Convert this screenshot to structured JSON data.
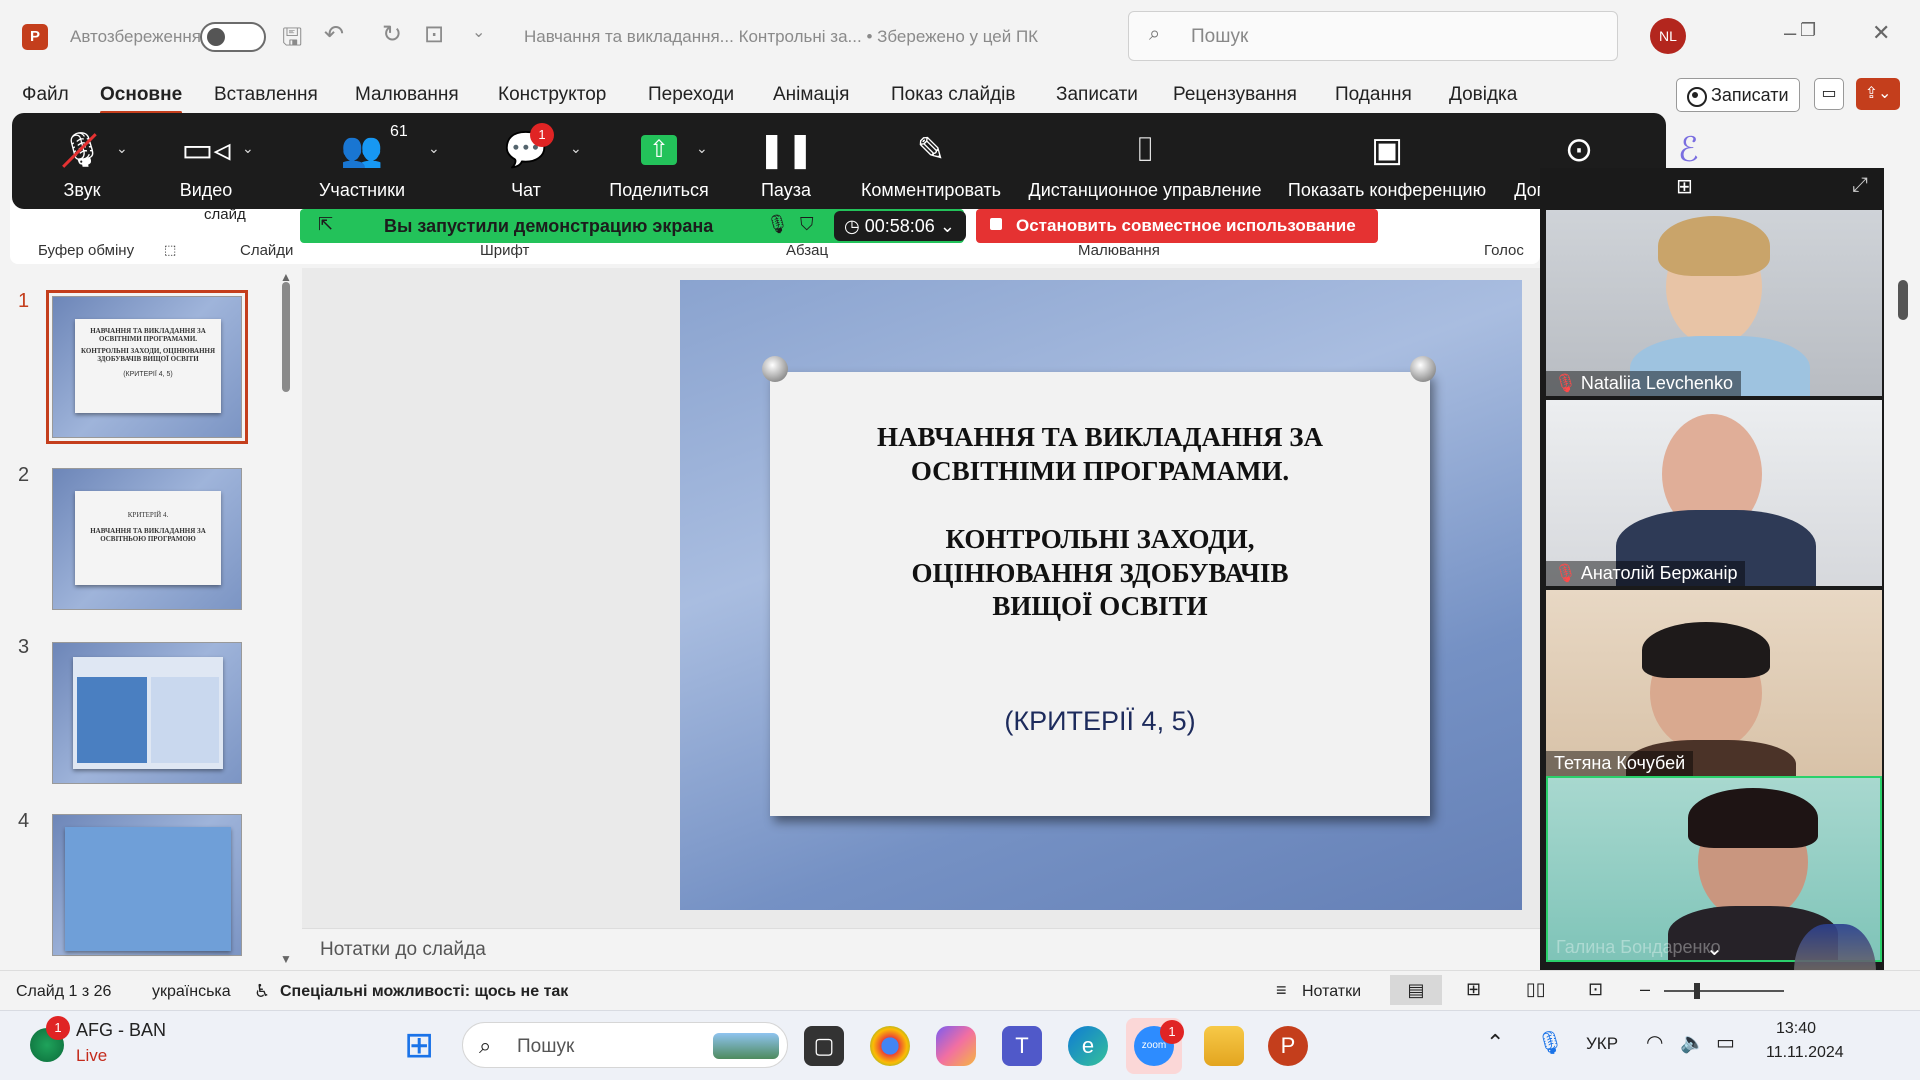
{
  "titlebar": {
    "autosave_label": "Автозбереження",
    "doc_title": "Навчання та викладання... Контрольні за... • Збережено у цей ПК",
    "search_placeholder": "Пошук",
    "user_initials": "NL"
  },
  "menu": {
    "items": [
      "Файл",
      "Основне",
      "Вставлення",
      "Малювання",
      "Конструктор",
      "Переходи",
      "Анімація",
      "Показ слайдів",
      "Записати",
      "Рецензування",
      "Подання",
      "Довідка"
    ],
    "active": "Основне",
    "record_label": "Записати"
  },
  "ribbon": {
    "groups": [
      "Буфер обміну",
      "Слайди",
      "Шрифт",
      "Абзац",
      "Малювання",
      "Голос"
    ],
    "slide_dropdown": "слайд"
  },
  "zoom": {
    "items": [
      {
        "label": "Звук",
        "icon": "mic-muted-icon"
      },
      {
        "label": "Видео",
        "icon": "video-camera-icon"
      },
      {
        "label": "Участники",
        "icon": "participants-icon",
        "count": "61"
      },
      {
        "label": "Чат",
        "icon": "chat-icon",
        "badge": "1"
      },
      {
        "label": "Поделиться",
        "icon": "share-screen-icon"
      },
      {
        "label": "Пауза",
        "icon": "pause-icon"
      },
      {
        "label": "Комментировать",
        "icon": "annotate-pen-icon"
      },
      {
        "label": "Дистанционное управление",
        "icon": "remote-control-mouse-icon"
      },
      {
        "label": "Показать конференцию",
        "icon": "show-meeting-icon"
      },
      {
        "label": "Дополнительно",
        "icon": "more-icon"
      }
    ],
    "share_status": "Вы запустили демонстрацию экрана",
    "timer": "00:58:06",
    "stop_share": "Остановить совместное использование"
  },
  "slides_panel": {
    "slides": [
      {
        "num": "1",
        "line1": "НАВЧАННЯ ТА ВИКЛАДАННЯ ЗА ОСВІТНІМИ ПРОГРАМАМИ.",
        "line2": "КОНТРОЛЬНІ ЗАХОДИ, ОЦІНЮВАННЯ ЗДОБУВАЧІВ ВИЩОЇ ОСВІТИ",
        "line3": "(КРИТЕРІЇ 4, 5)"
      },
      {
        "num": "2",
        "line1": "КРИТЕРІЙ 4.",
        "line2": "НАВЧАННЯ ТА ВИКЛАДАННЯ ЗА ОСВІТНЬОЮ ПРОГРАМОЮ"
      },
      {
        "num": "3"
      },
      {
        "num": "4"
      }
    ]
  },
  "main_slide": {
    "title_line1": "НАВЧАННЯ ТА ВИКЛАДАННЯ ЗА",
    "title_line2": "ОСВІТНІМИ ПРОГРАМАМИ.",
    "title_line3": "КОНТРОЛЬНІ ЗАХОДИ,",
    "title_line4": "ОЦІНЮВАННЯ ЗДОБУВАЧІВ",
    "title_line5": "ВИЩОЇ ОСВІТИ",
    "subtitle": "(КРИТЕРІЇ 4, 5)"
  },
  "notes_placeholder": "Нотатки до слайда",
  "participants": [
    {
      "name": "Nataliia Levchenko",
      "muted": true
    },
    {
      "name": "Анатолій Бержанір",
      "muted": true
    },
    {
      "name": "Тетяна Кочубей",
      "muted": false
    },
    {
      "name": "Галина Бондаренко",
      "muted": false
    }
  ],
  "statusbar": {
    "slide_counter": "Слайд 1 з 26",
    "language": "українська",
    "accessibility": "Спеціальні можливості: щось не так",
    "notes_label": "Нотатки"
  },
  "taskbar": {
    "widget_title": "AFG - BAN",
    "widget_sub": "Live",
    "widget_badge": "1",
    "search_label": "Пошук",
    "zoom_badge": "1",
    "lang": "УКР",
    "time": "13:40",
    "date": "11.11.2024"
  },
  "colors": {
    "ppt_accent": "#c43e1c",
    "zoom_green": "#23c25a",
    "zoom_red": "#e53232"
  }
}
